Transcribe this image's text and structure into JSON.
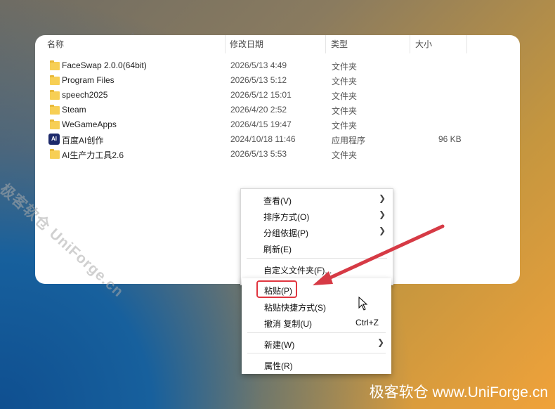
{
  "columns": {
    "name": "名称",
    "date": "修改日期",
    "type": "类型",
    "size": "大小"
  },
  "files": [
    {
      "name": "FaceSwap 2.0.0(64bit)",
      "date": "2026/5/13 4:49",
      "type": "文件夹",
      "size": "",
      "icon": "folder-icon"
    },
    {
      "name": "Program Files",
      "date": "2026/5/13 5:12",
      "type": "文件夹",
      "size": "",
      "icon": "folder-icon"
    },
    {
      "name": "speech2025",
      "date": "2026/5/12 15:01",
      "type": "文件夹",
      "size": "",
      "icon": "folder-icon"
    },
    {
      "name": "Steam",
      "date": "2026/4/20 2:52",
      "type": "文件夹",
      "size": "",
      "icon": "folder-icon"
    },
    {
      "name": "WeGameApps",
      "date": "2026/4/15 19:47",
      "type": "文件夹",
      "size": "",
      "icon": "folder-icon"
    },
    {
      "name": "百度AI创作",
      "date": "2024/10/18 11:46",
      "type": "应用程序",
      "size": "96 KB",
      "icon": "app-icon",
      "icon_text": "AI"
    },
    {
      "name": "AI生产力工具2.6",
      "date": "2026/5/13 5:53",
      "type": "文件夹",
      "size": "",
      "icon": "folder-icon"
    }
  ],
  "context_menu": {
    "view": "查看(V)",
    "sort": "排序方式(O)",
    "group": "分组依据(P)",
    "refresh": "刷新(E)",
    "customize": "自定义文件夹(F)...",
    "paste": "粘贴(P)",
    "paste_shortcut": "粘贴快捷方式(S)",
    "undo": "撤消 复制(U)",
    "undo_shortcut": "Ctrl+Z",
    "new": "新建(W)",
    "properties": "属性(R)"
  },
  "watermarks": {
    "diagonal": "极客软仓 UniForge.cn",
    "bottom": "极客软仓 www.UniForge.cn"
  },
  "colors": {
    "highlight": "#e0353f",
    "arrow": "#d63a45",
    "folder": "#f7cf55"
  }
}
